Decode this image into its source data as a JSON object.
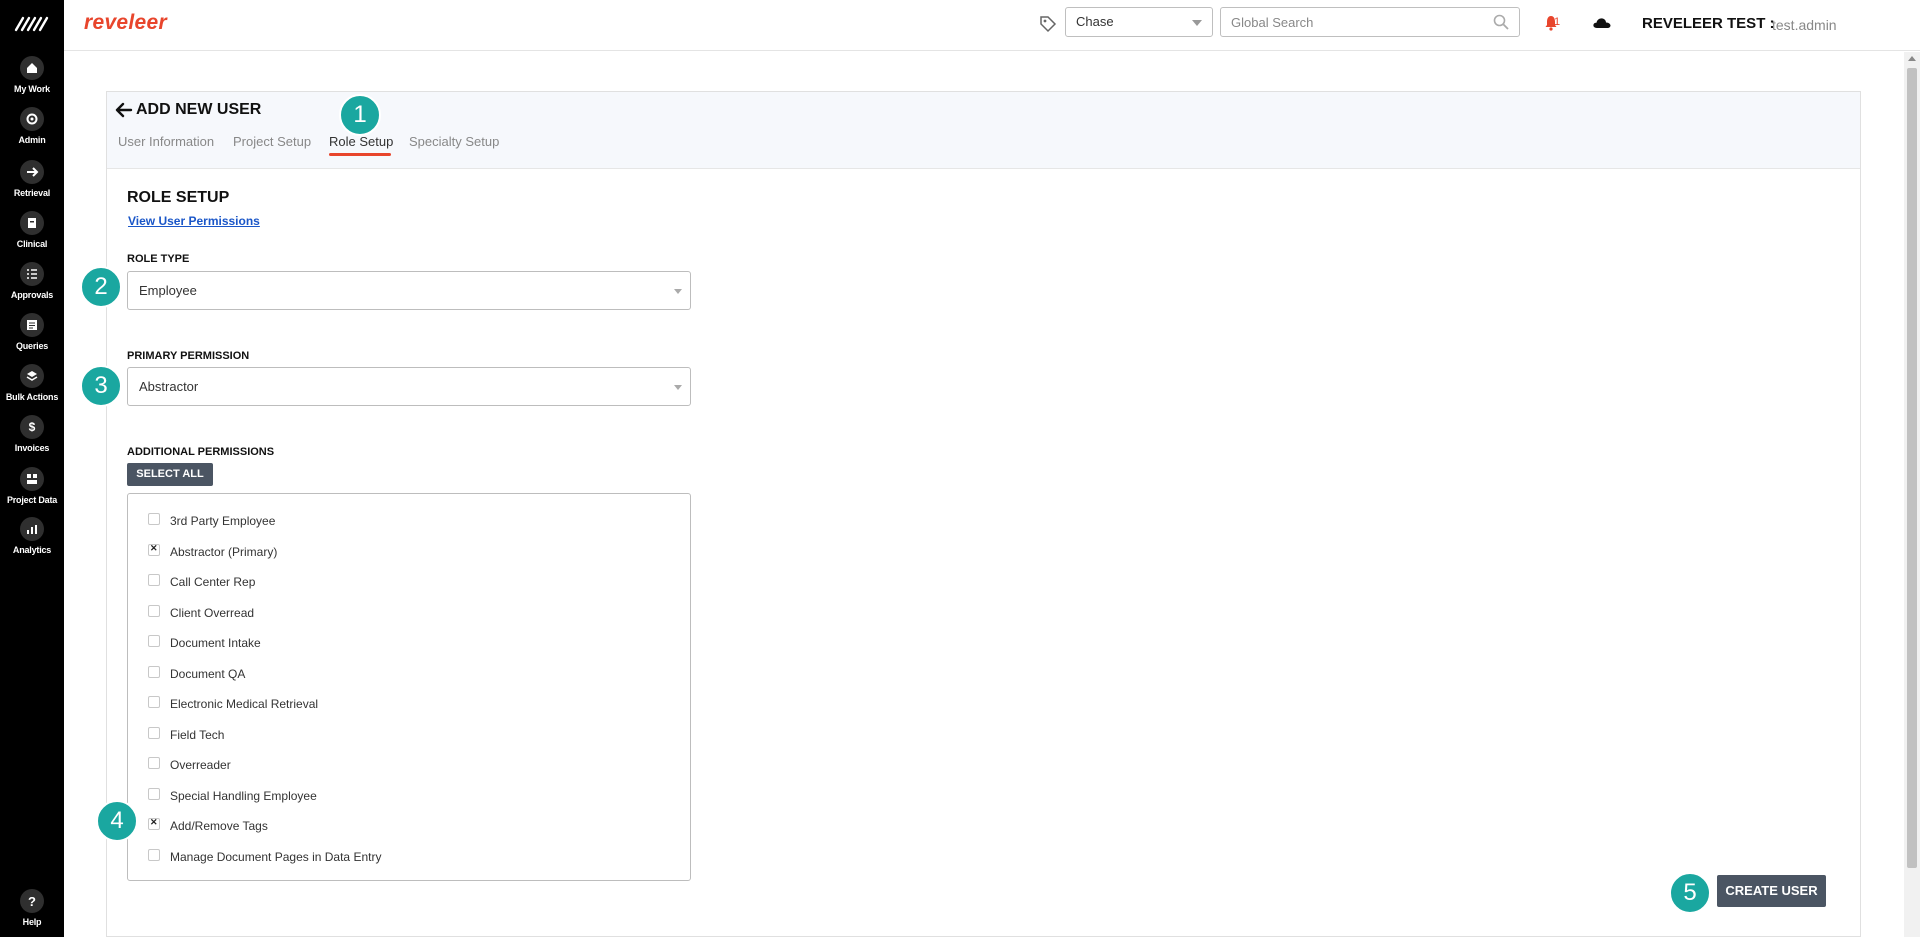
{
  "rail": {
    "items": [
      {
        "label": "My Work",
        "icon": "home-icon"
      },
      {
        "label": "Admin",
        "icon": "gear-icon"
      },
      {
        "label": "Retrieval",
        "icon": "arrow-right-icon"
      },
      {
        "label": "Clinical",
        "icon": "clipboard-icon"
      },
      {
        "label": "Approvals",
        "icon": "list-check-icon"
      },
      {
        "label": "Queries",
        "icon": "document-lines-icon"
      },
      {
        "label": "Bulk Actions",
        "icon": "layers-icon"
      },
      {
        "label": "Invoices",
        "icon": "dollar-icon"
      },
      {
        "label": "Project Data",
        "icon": "grid-icon"
      },
      {
        "label": "Analytics",
        "icon": "bar-chart-icon"
      }
    ],
    "help": {
      "label": "Help",
      "icon": "question-icon"
    }
  },
  "header": {
    "brand": "reveleer",
    "project_select_value": "Chase",
    "search_placeholder": "Global Search",
    "notification_count": "1",
    "org_label": "REVELEER TEST :",
    "username": "test.admin",
    "accent_color": "#e8452c"
  },
  "page": {
    "title": "ADD NEW USER",
    "tabs": [
      {
        "label": "User Information",
        "active": false
      },
      {
        "label": "Project Setup",
        "active": false
      },
      {
        "label": "Role Setup",
        "active": true
      },
      {
        "label": "Specialty Setup",
        "active": false
      }
    ],
    "section_title": "ROLE SETUP",
    "view_permissions_link": "View User Permissions",
    "role_type": {
      "label": "ROLE TYPE",
      "value": "Employee"
    },
    "primary_permission": {
      "label": "PRIMARY PERMISSION",
      "value": "Abstractor"
    },
    "additional_permissions": {
      "label": "ADDITIONAL PERMISSIONS",
      "select_all": "SELECT ALL",
      "items": [
        {
          "label": "3rd Party Employee",
          "checked": false
        },
        {
          "label": "Abstractor (Primary)",
          "checked": true
        },
        {
          "label": "Call Center Rep",
          "checked": false
        },
        {
          "label": "Client Overread",
          "checked": false
        },
        {
          "label": "Document Intake",
          "checked": false
        },
        {
          "label": "Document QA",
          "checked": false
        },
        {
          "label": "Electronic Medical Retrieval",
          "checked": false
        },
        {
          "label": "Field Tech",
          "checked": false
        },
        {
          "label": "Overreader",
          "checked": false
        },
        {
          "label": "Special Handling Employee",
          "checked": false
        },
        {
          "label": "Add/Remove Tags",
          "checked": true
        },
        {
          "label": "Manage Document Pages in Data Entry",
          "checked": false
        }
      ]
    },
    "create_button": "CREATE USER"
  },
  "callouts": [
    "1",
    "2",
    "3",
    "4",
    "5"
  ],
  "callout_color": "#1aa7a0"
}
